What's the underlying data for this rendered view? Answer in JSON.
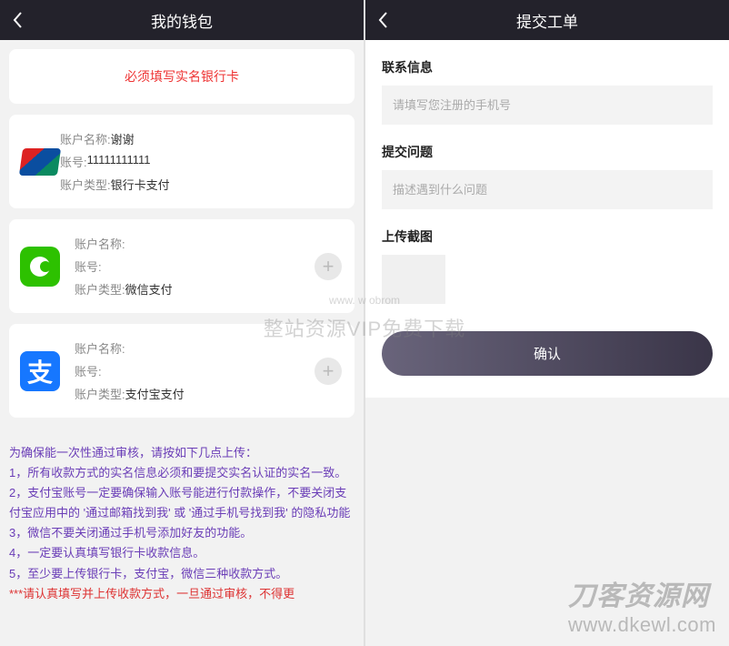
{
  "left": {
    "title": "我的钱包",
    "warning": "必须填写实名银行卡",
    "accounts": [
      {
        "icon": "unionpay",
        "name_label": "账户名称:",
        "name_value": "谢谢",
        "acct_label": "账号:",
        "acct_value": "11111111111",
        "type_label": "账户类型:",
        "type_value": "银行卡支付",
        "has_plus": false
      },
      {
        "icon": "wechat",
        "name_label": "账户名称:",
        "name_value": "",
        "acct_label": "账号:",
        "acct_value": "",
        "type_label": "账户类型:",
        "type_value": "微信支付",
        "has_plus": true
      },
      {
        "icon": "alipay",
        "name_label": "账户名称:",
        "name_value": "",
        "acct_label": "账号:",
        "acct_value": "",
        "type_label": "账户类型:",
        "type_value": "支付宝支付",
        "has_plus": true
      }
    ],
    "instructions_intro": "为确保能一次性通过审核，请按如下几点上传：",
    "instructions": [
      "1，所有收款方式的实名信息必须和要提交实名认证的实名一致。",
      "2，支付宝账号一定要确保输入账号能进行付款操作，不要关闭支付宝应用中的 '通过邮箱找到我'  或  '通过手机号找到我'  的隐私功能",
      "3，微信不要关闭通过手机号添加好友的功能。",
      "4，一定要认真填写银行卡收款信息。",
      "5，至少要上传银行卡，支付宝，微信三种收款方式。"
    ],
    "instructions_red": "***请认真填写并上传收款方式，一旦通过审核，不得更"
  },
  "right": {
    "title": "提交工单",
    "contact_label": "联系信息",
    "contact_placeholder": "请填写您注册的手机号",
    "issue_label": "提交问题",
    "issue_placeholder": "描述遇到什么问题",
    "upload_label": "上传截图",
    "confirm": "确认"
  },
  "watermark": {
    "center": "整站资源VIP免费下载",
    "url_small": "www.   w   obrom",
    "brand_cn": "刀客资源网",
    "brand_en": "www.dkewl.com"
  }
}
